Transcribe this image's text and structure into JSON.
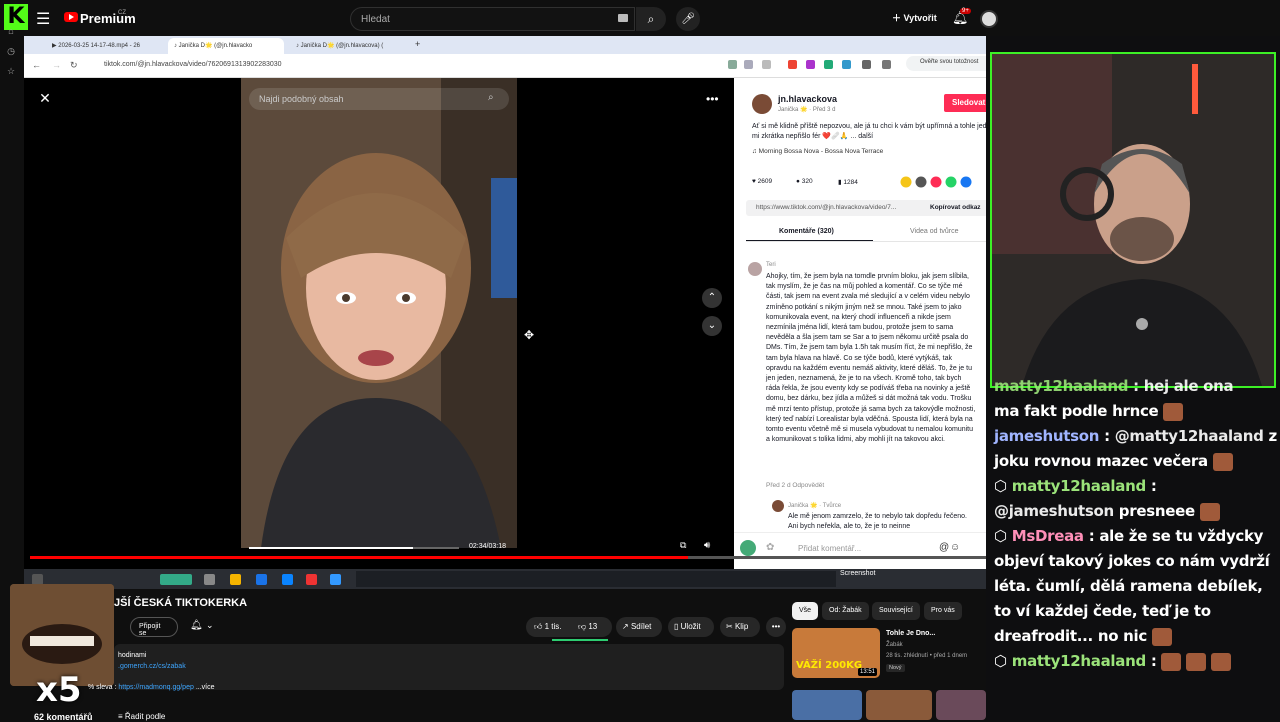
{
  "youtube": {
    "logo_text": "Premium",
    "logo_region": "CZ",
    "search_placeholder": "Hledat",
    "create_label": "Vytvořit",
    "notifications_badge": "9+",
    "channel_title": "JŠÍ ČESKÁ TIKTOKERKA",
    "join_label": "Připojit se",
    "like_label": "1 tis.",
    "dislike_label": "13",
    "share_label": "Sdílet",
    "save_label": "Uložit",
    "clip_label": "Klip",
    "description": {
      "line1": "hodinami",
      "line2": ".gomerch.cz/cs/zabak",
      "line3_prefix": "% sleva : ",
      "line3_link": "https://madmonq.gg/pep",
      "line3_more": "...více"
    },
    "comments_count": "62 komentářů",
    "sort_label": "Řadit podle",
    "progress_fraction": 0.685,
    "chips": [
      "Vše",
      "Od: Žabák",
      "Související",
      "Pro vás"
    ],
    "recommendation": {
      "title": "Tohle Je Dno...",
      "channel": "Žabák",
      "meta": "28 tis. zhlédnutí • před 1 dnem",
      "badge": "Nový",
      "duration": "13:51",
      "thumb_text": "VÁŽÍ 200KG"
    },
    "overlay_text": "x5"
  },
  "browser": {
    "tabs": [
      {
        "label": "2026-03-25 14-17-48.mp4 - 26"
      },
      {
        "label": "Janička D🌟 (@jn.hlavacko"
      },
      {
        "label": "Janička D🌟 (@jn.hlavacova) ("
      }
    ],
    "url": "tiktok.com/@jn.hlavackova/video/7620691313902283030",
    "verify_label": "Ověřte svou totožnost"
  },
  "tiktok": {
    "search_placeholder": "Najdi podobný obsah",
    "time": "02:34/03:18",
    "progress_fraction": 0.78,
    "username": "jn.hlavackova",
    "user_sub": "Janička 🌟 · Před 3 d",
    "follow_label": "Sledovat",
    "caption": "Ať si mě klidně příště nepozvou, ale já tu chci k vám být upřímná a tohle jednání mi zkrátka nepřišlo fér ❤️🩹🙏 ... další",
    "music": "♫ Morning Bossa Nova - Bossa Nova Terrace",
    "likes": "2609",
    "comments": "320",
    "saves": "1284",
    "link": "https://www.tiktok.com/@jn.hlavackova/video/7...",
    "copy_label": "Kopírovat odkaz",
    "tab_comments": "Komentáře (320)",
    "tab_videos": "Videa od tvůrce",
    "comment": {
      "author": "Teri",
      "text": "Ahojky, tím, že jsem byla na tomdle prvním bloku, jak jsem slíbila, tak myslím, že je čas na můj pohled a komentář. Co se týče mé části, tak jsem na event zvala mé sledující a v celém videu nebylo zmíněno potkání s nikým jiným než se mnou. Také jsem to jako komunikovala event, na který chodí influenceři a nikde jsem nezmínila jména lidí, která tam budou, protože jsem to sama nevěděla a šla jsem tam se Sar a to jsem někomu určitě psala do DMs. Tím, že jsem tam byla 1.5h tak musím říct, že mi nepřišlo, že tam byla hlava na hlavě. Co se týče bodů, které vytýkáš, tak opravdu na každém eventu nemáš aktivity, které děláš. To, že je tu jen jeden, neznamená, že je to na všech. Kromě toho, tak bych ráda řekla, že jsou eventy kdy se podíváš třeba na novinky a ještě domu, bez dárku, bez jídla a můžeš si dát možná tak vodu. Trošku mě mrzí tento přístup, protože já sama bych za takovýdle možnosti, který teď nabízí Lorealistar byla vděčná. Spousta lidí, která byla na tomto eventu včetně mě si musela vybudovat tu nemalou komunitu a komunikovat s tolika lidmi, aby mohli jít na takovou akci.",
      "meta": "Před 2 d   Odpovědět",
      "reply_author": "Janička 🌟 · Tvůrce",
      "reply_text": "Ale mě jenom zamrzelo, že to nebylo tak dopředu řečeno. Ani bych neřekla, ale to, že je to neinne"
    },
    "comment_placeholder": "Přidat komentář..."
  },
  "taskbar": {
    "screenshot_label": "Screenshot"
  },
  "chat": {
    "messages": [
      {
        "user": "matty12haaland",
        "text": "hej ale ona",
        "line2": "ma fakt podle hrnce"
      },
      {
        "user": "jameshutson",
        "mention": "@matty12haaland",
        "text": "z",
        "line2": "joku rovnou mazec večera"
      },
      {
        "user": "matty12haaland",
        "text": ""
      },
      {
        "user": "",
        "mention": "@jameshutson",
        "text": "presneee"
      },
      {
        "user": "MsDreaa",
        "text": "ale že se tu vždycky objeví takový jokes co nám vydrží léta. čumlí, dělá ramena debílek, to ví každej čede, teď je to dreafrodit... no nic"
      },
      {
        "user": "matty12haaland",
        "text": ""
      }
    ]
  },
  "colors": {
    "youtube_red": "#ff0000",
    "tiktok_pink": "#fe2c55",
    "kick_green": "#53fc18",
    "chat_user": "#9be37a"
  }
}
